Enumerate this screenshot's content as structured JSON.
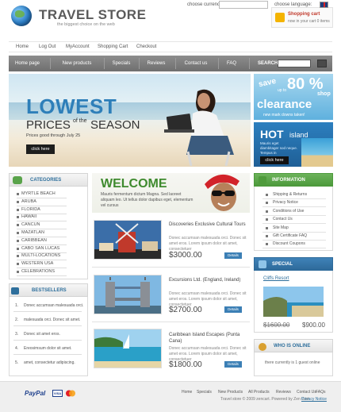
{
  "header": {
    "logo_title": "TRAVEL STORE",
    "logo_tagline": "the biggest choice on the web",
    "cart_title": "Shopping cart",
    "cart_text": "now in your cart 0 items"
  },
  "toplinks": [
    "Home",
    "Log Out",
    "MyAccount",
    "Shopping Cart",
    "Checkout"
  ],
  "currency_label": "choose currency:",
  "language_label": "choose language:",
  "nav": [
    "Home page",
    "New products",
    "Specials",
    "Reviews",
    "Contact us",
    "FAQ"
  ],
  "search_label": "SEARCH",
  "hero": {
    "lowest": "LOWEST",
    "prices": "PRICES",
    "of_the": "of the",
    "season": "SEASON",
    "good": "Prices good through July 25",
    "click": "click here"
  },
  "promo_clearance": {
    "save": "save",
    "upto": "up to",
    "percent": "80 %",
    "shop": "shop",
    "clearance": "clearance",
    "markdowns": "new mark downs taken!"
  },
  "promo_hot": {
    "hot": "HOT",
    "island": "island",
    "text": "Mauris eget diambitager sod neque.   Tempus in",
    "click": "click here"
  },
  "categories": {
    "title": "CATEGORIES",
    "items": [
      "MYRTLE BEACH",
      "ARUBA",
      "FLORIDA",
      "HAWAII",
      "CANCUN",
      "MAZATLAN",
      "CARIBBEAN",
      "CABO SAN LUCAS",
      "MULTI-LOCATIONS",
      "WESTERN USA",
      "CELEBRATIONS"
    ]
  },
  "bestsellers": {
    "title": "BESTSELLERS",
    "items": [
      {
        "num": "1.",
        "text": "Donec accumsan malesuada orci."
      },
      {
        "num": "2.",
        "text": "malesuada orci. Donec sit amet."
      },
      {
        "num": "3.",
        "text": "Donec sit amet eros."
      },
      {
        "num": "4.",
        "text": "Ereosimsum dolor sit amet."
      },
      {
        "num": "5.",
        "text": "amet, consectetur adipiscing."
      }
    ]
  },
  "welcome": {
    "title": "WELCOME",
    "text": "Mauris fermentum dictum Magna. Sed laoreet aliquam leo. Ut tellus dolor dapibus eget, elementum vel cursus"
  },
  "products": [
    {
      "title": "Discoveries Exclusive Cultural Tours",
      "desc": "Donec accumsan malesuada orci. Donec sit amet eros. Lorem ipsum dolor sit amet, consectetuer",
      "price": "$3000.00",
      "details": "Details"
    },
    {
      "title": "Excursions Ltd. (England, Ireland)",
      "desc": "Donec accumsan malesuada orci. Donec sit amet eros. Lorem ipsum dolor sit amet, consectetuer",
      "price": "$2700.00",
      "details": "Details"
    },
    {
      "title": "Caribbean Island Escapes (Punta Cana)",
      "desc": "Donec accumsan malesuada orci. Donec sit amet eros. Lorem ipsum dolor sit amet, consectetuer",
      "price": "$1800.00",
      "details": "Details"
    }
  ],
  "information": {
    "title": "INFORMATION",
    "items": [
      "Shipping & Returns",
      "Privacy Notice",
      "Conditions of Use",
      "Contact Us",
      "Site Map",
      "Gift Certificate FAQ",
      "Discount Coupons"
    ]
  },
  "special": {
    "title": "SPECIAL",
    "link": "Cliffs Resort",
    "old_price": "$1600.00",
    "new_price": "$900.00"
  },
  "online": {
    "title": "WHO IS ONLINE",
    "text": "there currently is 1 guest online"
  },
  "footer": {
    "links": [
      "Home",
      "Specials",
      "New Products",
      "All Products",
      "Reviews",
      "Contact Us",
      "FAQs"
    ],
    "paypal": "PayPal",
    "visa": "VISA",
    "copy": "Travel store © 2009 zencart. Powered by Zen Cart",
    "privacy": "Privacy Notice"
  }
}
